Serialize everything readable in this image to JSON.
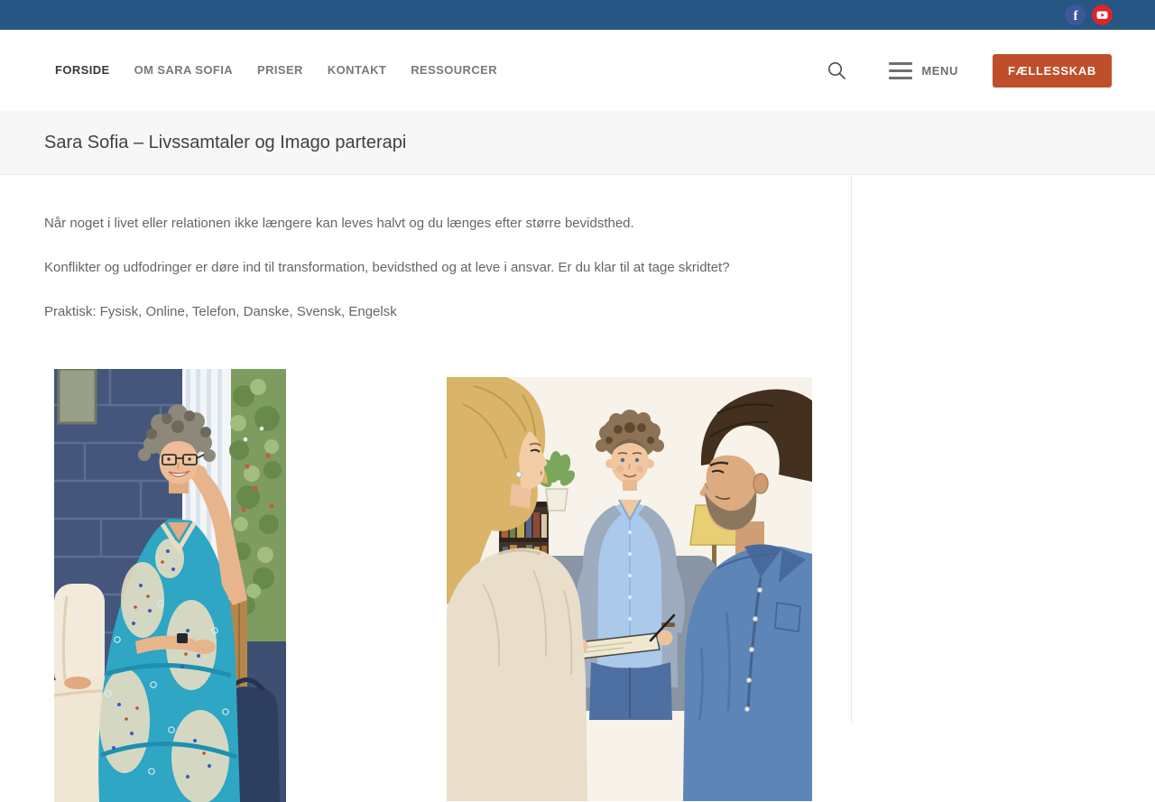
{
  "topbar": {
    "social": [
      {
        "icon": "facebook-icon",
        "color": "#3b5998"
      },
      {
        "icon": "youtube-icon",
        "color": "#d8262c"
      }
    ]
  },
  "nav": {
    "items": [
      {
        "label": "FORSIDE",
        "active": true
      },
      {
        "label": "OM SARA SOFIA",
        "active": false
      },
      {
        "label": "PRISER",
        "active": false
      },
      {
        "label": "KONTAKT",
        "active": false
      },
      {
        "label": "RESSOURCER",
        "active": false
      }
    ],
    "search_icon": "search-icon",
    "menu_icon": "hamburger-icon",
    "menu_label": "MENU",
    "cta_label": "FÆLLESSKAB"
  },
  "page": {
    "title": "Sara Sofia – Livssamtaler og Imago parterapi"
  },
  "content": {
    "paragraphs": [
      "Når noget i livet eller relationen ikke længere kan leves halvt og du længes efter større bevidsthed.",
      "Konflikter og udfodringer er døre ind til transformation, bevidsthed og at leve i ansvar. Er du klar til at tage skridtet?",
      "Praktisk: Fysisk, Online, Telefon, Danske, Svensk, Engelsk"
    ],
    "illustrations": [
      {
        "name": "woman-on-sofa-illustration"
      },
      {
        "name": "imago-therapy-session-illustration"
      }
    ]
  },
  "colors": {
    "topbar_bg": "#265683",
    "cta_accent": "#bf4e2b",
    "facebook": "#3b5998",
    "youtube": "#d8262c",
    "titlebar_bg": "#f7f7f7",
    "body_text": "#666666"
  }
}
